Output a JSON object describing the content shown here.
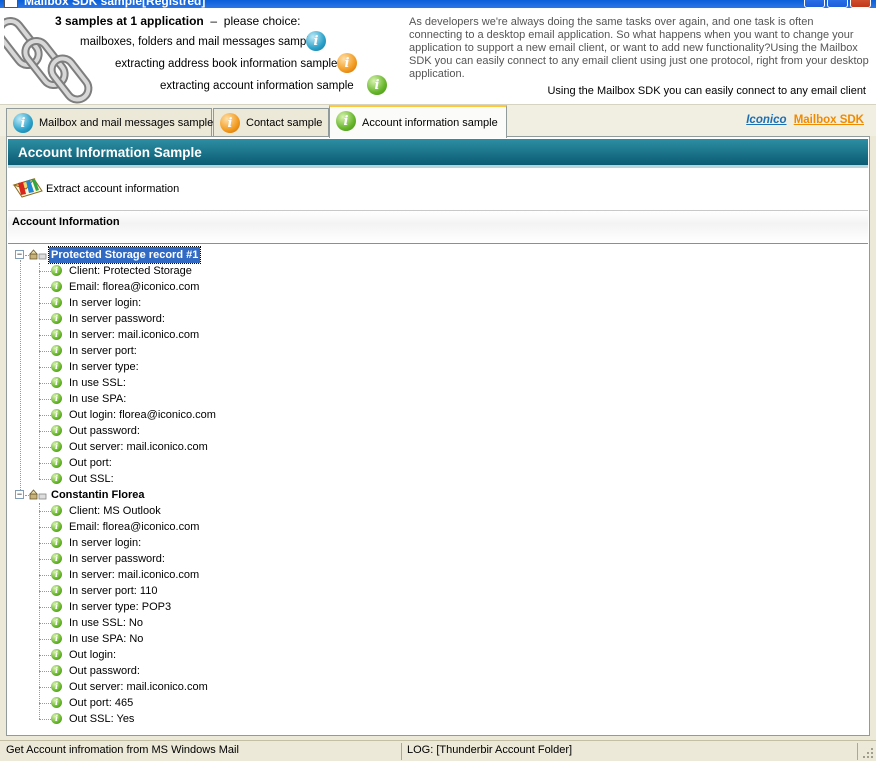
{
  "window": {
    "title": "Mailbox SDK sample[Registred]"
  },
  "header": {
    "samples_count": "3 samples at 1 application",
    "samples_dash": "–",
    "samples_prompt": "please choice:",
    "links": [
      {
        "label": "mailboxes, folders and mail messages sample",
        "icon": "info-blue-icon"
      },
      {
        "label": "extracting address book information sample",
        "icon": "info-orange-icon"
      },
      {
        "label": "extracting account information sample",
        "icon": "info-green-icon"
      }
    ],
    "intro": "As developers we're always doing the same tasks over again, and one task is often connecting to a desktop email application. So what happens when you want to change your application to support a new email client, or want to add new functionality?Using the Mailbox SDK you can easily connect to any email client using just one protocol, right from your desktop application.",
    "tagline": "Using the Mailbox SDK you can easily connect to any email client"
  },
  "tabs": [
    {
      "label": "Mailbox and mail messages sample",
      "icon": "info-blue-icon",
      "active": false
    },
    {
      "label": "Contact sample",
      "icon": "info-orange-icon",
      "active": false
    },
    {
      "label": "Account information sample",
      "icon": "info-green-icon",
      "active": true
    }
  ],
  "brand": {
    "company": "Iconico",
    "product": "Mailbox SDK"
  },
  "main": {
    "section_title": "Account Information Sample",
    "extract_button": "Extract account information",
    "account_info_label": "Account Information"
  },
  "tree": [
    {
      "label": "Protected Storage record #1",
      "selected": true,
      "children": [
        "Client: Protected Storage",
        "Email: florea@iconico.com",
        "In server login:",
        "In server password:",
        "In server: mail.iconico.com",
        "In server port:",
        "In server type:",
        "In use SSL:",
        "In use SPA:",
        "Out login: florea@iconico.com",
        "Out password:",
        "Out server: mail.iconico.com",
        "Out port:",
        "Out SSL:"
      ]
    },
    {
      "label": "Constantin Florea",
      "selected": false,
      "children": [
        "Client: MS Outlook",
        "Email: florea@iconico.com",
        "In server login:",
        "In server password:",
        "In server: mail.iconico.com",
        "In server port: 110",
        "In server type: POP3",
        "In use SSL: No",
        "In use SPA: No",
        "Out login:",
        "Out password:",
        "Out server: mail.iconico.com",
        "Out port: 465",
        "Out SSL: Yes"
      ]
    }
  ],
  "status": {
    "left": "Get Account infromation from MS Windows Mail",
    "right": "LOG: [Thunderbir Account Folder]"
  }
}
